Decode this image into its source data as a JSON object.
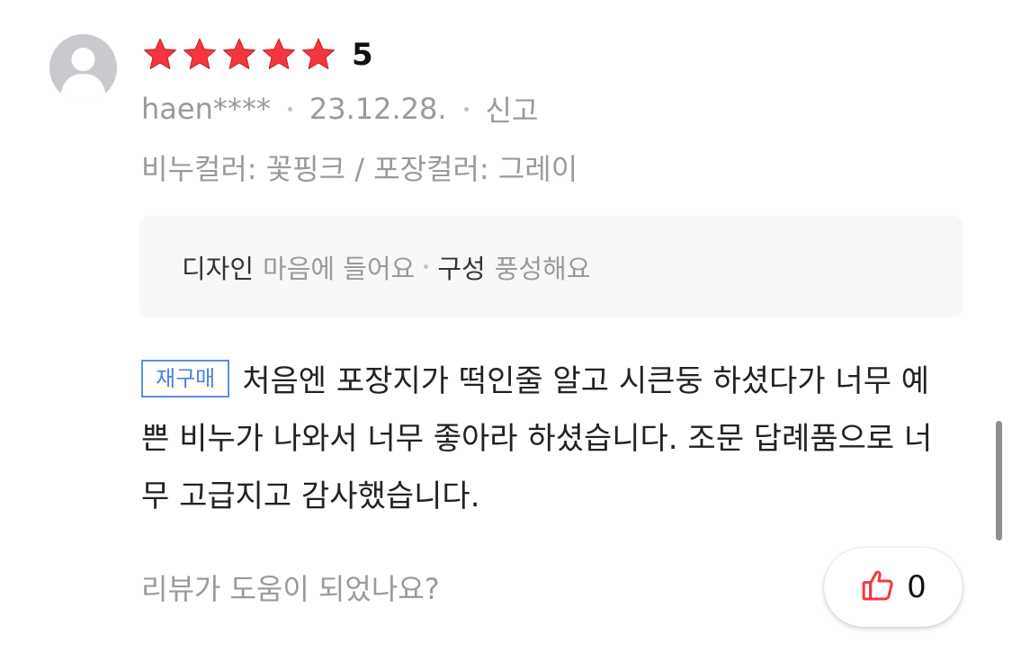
{
  "review": {
    "rating": {
      "stars_filled": 5,
      "stars_total": 5,
      "score_label": "5",
      "star_color": "#f5363f"
    },
    "meta": {
      "author": "haen****",
      "date": "23.12.28.",
      "report_label": "신고"
    },
    "options": "비누컬러: 꽃핑크 / 포장컬러: 그레이",
    "survey": [
      {
        "key": "디자인",
        "value": "마음에 들어요"
      },
      {
        "key": "구성",
        "value": "풍성해요"
      }
    ],
    "badge_label": "재구매",
    "text": "처음엔 포장지가 떡인줄 알고 시큰둥 하셨다가 너무 예쁜 비누가 나와서 너무 좋아라 하셨습니다. 조문 답례품으로 너무 고급지고 감사했습니다.",
    "helpful_question": "리뷰가 도움이 되었나요?",
    "like": {
      "count": "0",
      "icon": "thumbs-up-icon",
      "icon_color": "#f5363f"
    }
  },
  "colors": {
    "accent_blue": "#4a83dd",
    "muted_text": "#9a9a9a",
    "survey_bg": "#f7f8fa"
  }
}
